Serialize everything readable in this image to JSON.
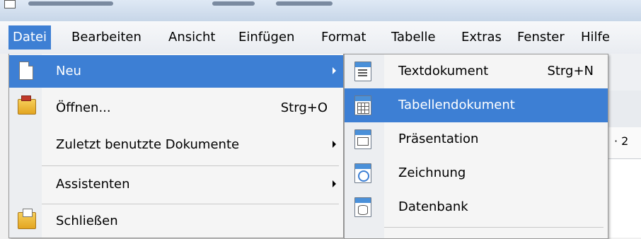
{
  "menubar": {
    "items": [
      {
        "label": "Datei",
        "active": true
      },
      {
        "label": "Bearbeiten"
      },
      {
        "label": "Ansicht"
      },
      {
        "label": "Einfügen"
      },
      {
        "label": "Format"
      },
      {
        "label": "Tabelle"
      },
      {
        "label": "Extras"
      },
      {
        "label": "Fenster"
      },
      {
        "label": "Hilfe"
      }
    ]
  },
  "file_menu": {
    "items": [
      {
        "label": "Neu",
        "icon": "new-document-icon",
        "has_submenu": true,
        "highlighted": true
      },
      {
        "label": "Öffnen...",
        "shortcut": "Strg+O",
        "icon": "open-folder-icon"
      },
      {
        "label": "Zuletzt benutzte Dokumente",
        "has_submenu": true
      },
      {
        "label": "Assistenten",
        "has_submenu": true
      },
      {
        "label": "Schließen",
        "icon": "close-document-icon"
      }
    ]
  },
  "new_submenu": {
    "items": [
      {
        "label": "Textdokument",
        "shortcut": "Strg+N",
        "icon": "text-document-icon"
      },
      {
        "label": "Tabellendokument",
        "icon": "spreadsheet-icon",
        "highlighted": true
      },
      {
        "label": "Präsentation",
        "icon": "presentation-icon"
      },
      {
        "label": "Zeichnung",
        "icon": "drawing-icon"
      },
      {
        "label": "Datenbank",
        "icon": "database-icon"
      }
    ]
  },
  "background": {
    "ruler_value": "· 2"
  },
  "colors": {
    "highlight": "#3d7fd4",
    "menu_bg": "#f5f5f5"
  }
}
